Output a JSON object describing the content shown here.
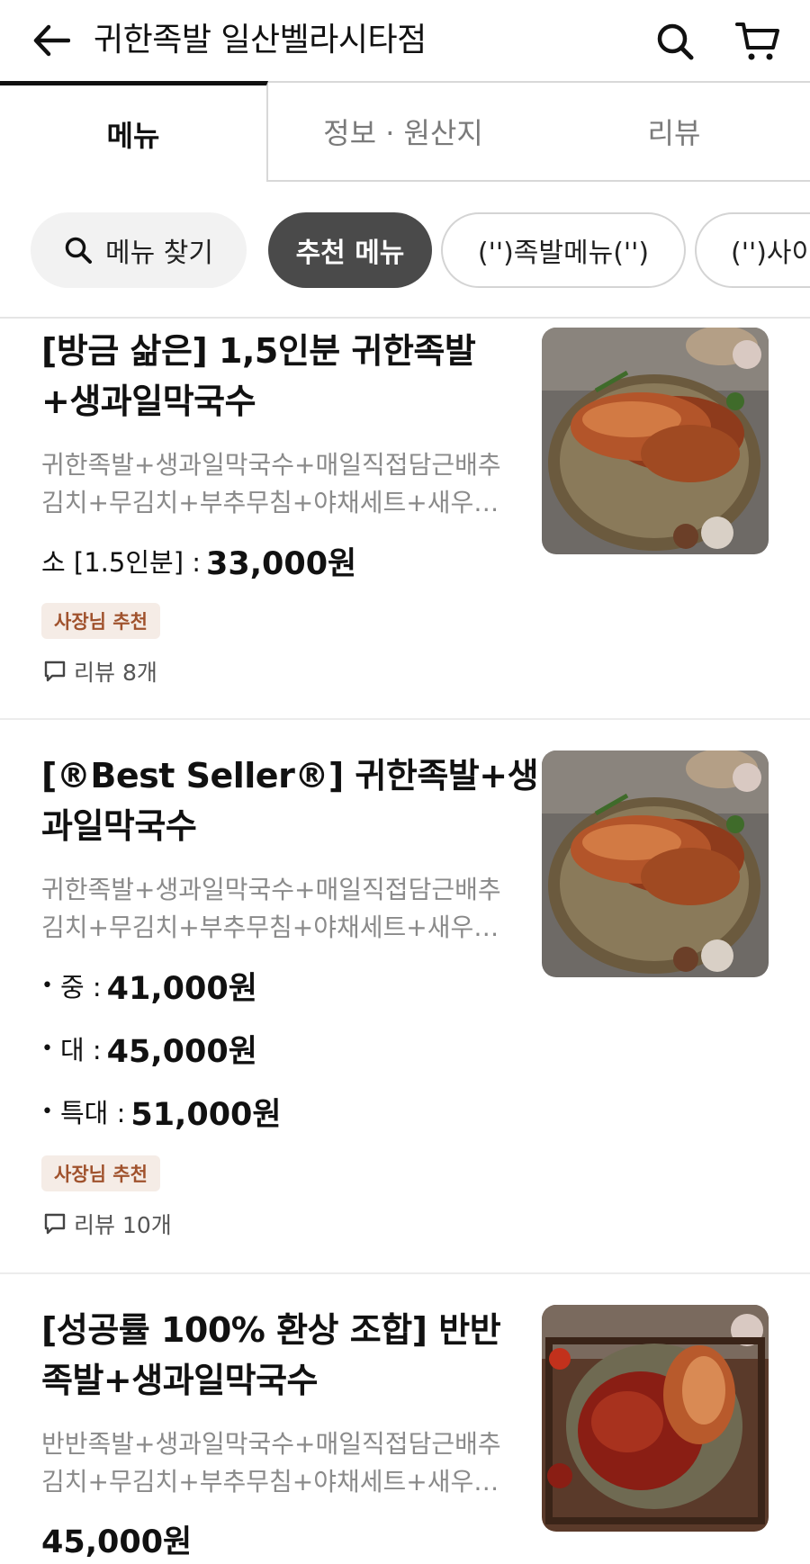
{
  "header": {
    "title": "귀한족발 일산벨라시타점",
    "back_icon": "arrow-left-icon",
    "search_icon": "search-icon",
    "cart_icon": "cart-icon"
  },
  "tabs": [
    {
      "label": "메뉴",
      "active": true
    },
    {
      "label": "정보 · 원산지",
      "active": false
    },
    {
      "label": "리뷰",
      "active": false
    }
  ],
  "chips": {
    "search_label": "메뉴 찾기",
    "items": [
      "추천 메뉴",
      "('')족발메뉴('')",
      "('')사이"
    ]
  },
  "menu_items": [
    {
      "name_lines": [
        "[방금 삶은] 1,5인분 귀한족발",
        "+생과일막국수"
      ],
      "desc_lines": [
        "귀한족발+생과일막국수+매일직접담근배추",
        "김치+무김치+부추무침+야채세트+새우…"
      ],
      "prices": [
        {
          "label": "소 [1.5인분] :",
          "amount": "33,000원"
        }
      ],
      "badge": "사장님 추천",
      "reviews": "리뷰 8개"
    },
    {
      "name_lines": [
        "[®Best Seller®]  귀한족발+생",
        "과일막국수"
      ],
      "desc_lines": [
        "귀한족발+생과일막국수+매일직접담근배추",
        "김치+무김치+부추무침+야채세트+새우…"
      ],
      "prices": [
        {
          "label": "중 :",
          "amount": "41,000원"
        },
        {
          "label": "대 :",
          "amount": "45,000원"
        },
        {
          "label": "특대 :",
          "amount": "51,000원"
        }
      ],
      "badge": "사장님 추천",
      "reviews": "리뷰 10개"
    },
    {
      "name_lines": [
        "[성공률 100% 환상 조합] 반반",
        "족발+생과일막국수"
      ],
      "desc_lines": [
        "반반족발+생과일막국수+매일직접담근배추",
        "김치+무김치+부추무침+야채세트+새우…"
      ],
      "price": "45,000원"
    }
  ],
  "colors": {
    "accent_dark": "#4a4a4a",
    "badge_bg": "#f5ece6",
    "badge_text": "#a0522d",
    "muted_text": "#8a8a8a"
  }
}
